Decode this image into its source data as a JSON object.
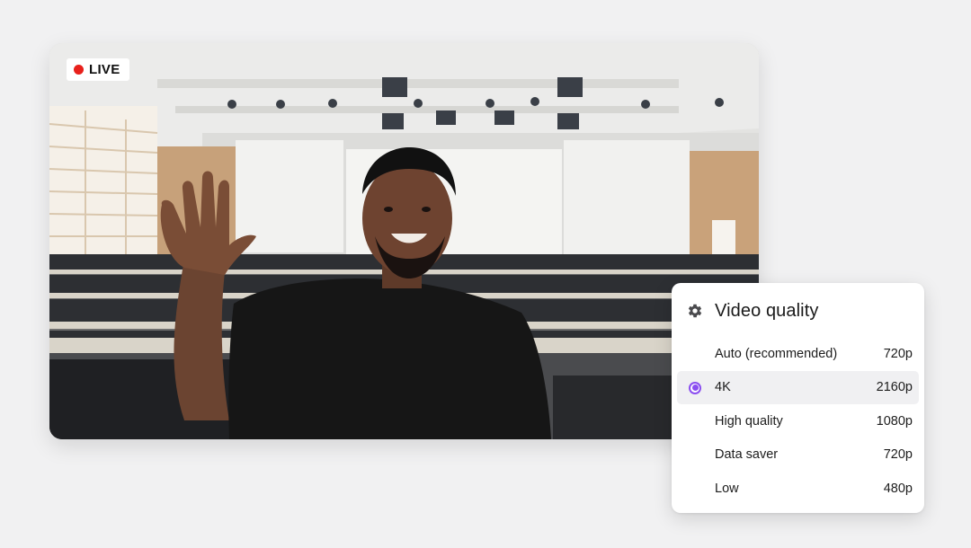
{
  "live_badge": {
    "label": "LIVE",
    "color": "#e8201b"
  },
  "video_quality": {
    "title": "Video quality",
    "accent_color": "#8a4df0",
    "options": [
      {
        "label": "Auto (recommended)",
        "value": "720p",
        "selected": false
      },
      {
        "label": "4K",
        "value": "2160p",
        "selected": true
      },
      {
        "label": "High quality",
        "value": "1080p",
        "selected": false
      },
      {
        "label": "Data saver",
        "value": "720p",
        "selected": false
      },
      {
        "label": "Low",
        "value": "480p",
        "selected": false
      }
    ]
  }
}
